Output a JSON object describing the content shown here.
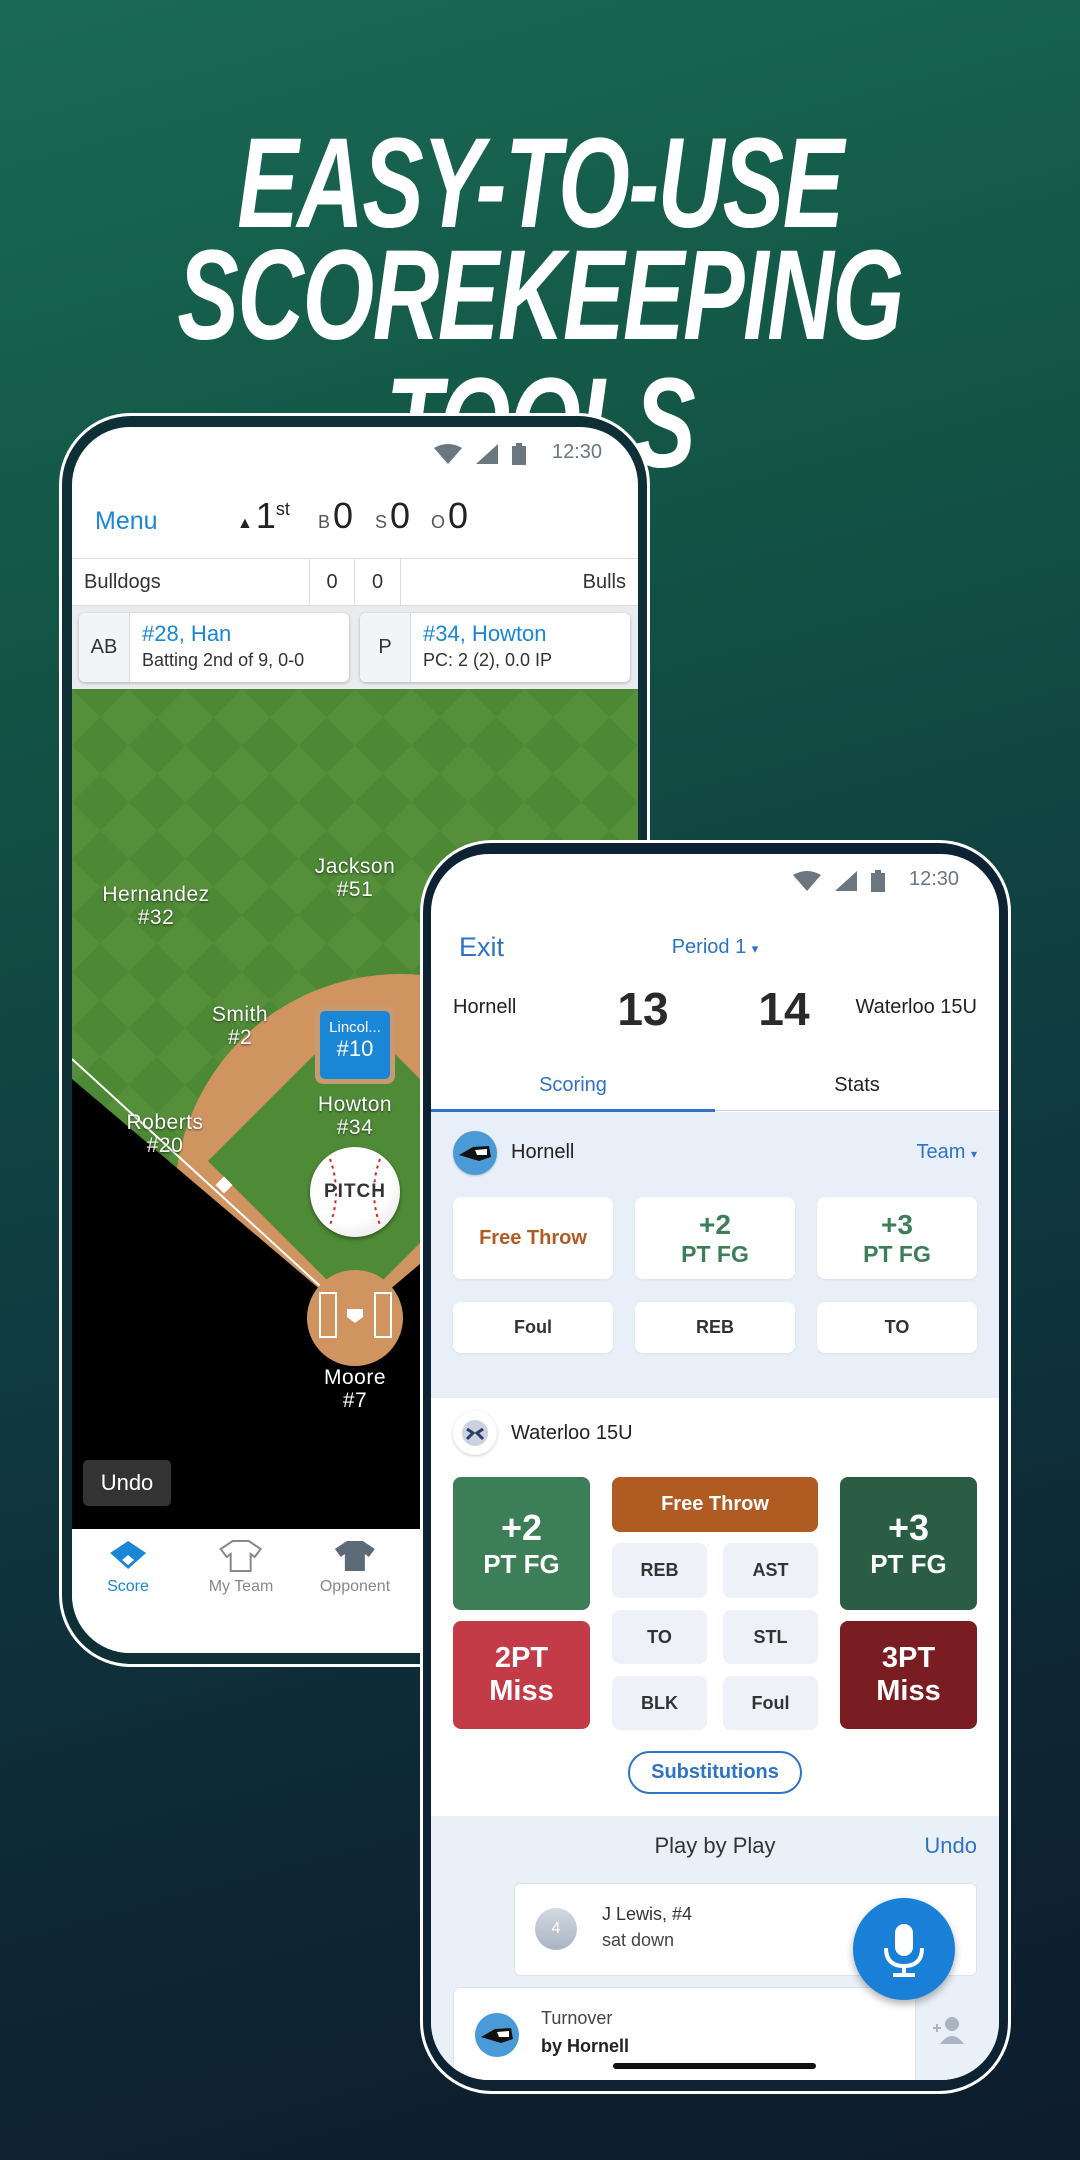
{
  "headline": {
    "line1": "EASY-TO-USE",
    "line2": "SCOREKEEPING TOOLS"
  },
  "colors": {
    "baseball_blue": "#1a86d6",
    "app_blue": "#2f73c5",
    "green_2pt": "#3b7e58",
    "green_3pt": "#2a5d43",
    "red_2pt_miss": "#c23b46",
    "red_3pt_miss": "#7a1d23",
    "orange_free_throw": "#b05b22",
    "field_green": "#4f8a36",
    "infield_dirt": "#d09461"
  },
  "baseball_app": {
    "status": {
      "time": "12:30",
      "icons": [
        "wifi-icon",
        "signal-icon",
        "battery-icon"
      ]
    },
    "header": {
      "menu": "Menu",
      "inning_arrow": "▲",
      "inning": "1",
      "inning_suffix": "st",
      "balls_label": "B",
      "balls": "0",
      "strikes_label": "S",
      "strikes": "0",
      "outs_label": "O",
      "outs": "0"
    },
    "scoreboard": {
      "away_team": "Bulldogs",
      "away_score": "0",
      "home_score": "0",
      "home_team": "Bulls"
    },
    "at_bat": {
      "label": "AB",
      "name": "#28, Han",
      "detail": "Batting 2nd of 9, 0-0"
    },
    "pitcher": {
      "label": "P",
      "name": "#34, Howton",
      "detail": "PC: 2 (2), 0.0 IP"
    },
    "field_players": [
      {
        "name": "Hernandez",
        "number": "#32"
      },
      {
        "name": "Jackson",
        "number": "#51"
      },
      {
        "name": "Smith",
        "number": "#2"
      },
      {
        "name": "Roberts",
        "number": "#20"
      },
      {
        "name": "Howton",
        "number": "#34"
      },
      {
        "name": "Moore",
        "number": "#7"
      }
    ],
    "runner": {
      "name": "Lincol...",
      "number": "#10"
    },
    "pitch_button": "PITCH",
    "undo": "Undo",
    "nav": [
      {
        "label": "Score",
        "icon": "diamond-icon",
        "active": true
      },
      {
        "label": "My Team",
        "icon": "jersey-outline-icon",
        "active": false
      },
      {
        "label": "Opponent",
        "icon": "jersey-filled-icon",
        "active": false
      }
    ]
  },
  "basketball_app": {
    "status": {
      "time": "12:30"
    },
    "header": {
      "exit": "Exit",
      "period": "Period 1",
      "period_caret": "▾"
    },
    "score": {
      "home_team": "Hornell",
      "home_score": "13",
      "away_score": "14",
      "away_team": "Waterloo 15U"
    },
    "tabs": [
      {
        "label": "Scoring",
        "active": true
      },
      {
        "label": "Stats",
        "active": false
      }
    ],
    "team1": {
      "name": "Hornell",
      "selector": "Team",
      "selector_caret": "▾",
      "buttons": {
        "free_throw": "Free Throw",
        "two_pt_top": "+2",
        "two_pt_bottom": "PT FG",
        "three_pt_top": "+3",
        "three_pt_bottom": "PT FG",
        "foul": "Foul",
        "reb": "REB",
        "to": "TO"
      }
    },
    "team2": {
      "name": "Waterloo 15U",
      "buttons": {
        "two_pt_top": "+2",
        "two_pt_bottom": "PT FG",
        "three_pt_top": "+3",
        "three_pt_bottom": "PT FG",
        "miss2_top": "2PT",
        "miss2_bottom": "Miss",
        "miss3_top": "3PT",
        "miss3_bottom": "Miss",
        "free_throw": "Free Throw",
        "reb": "REB",
        "ast": "AST",
        "to": "TO",
        "stl": "STL",
        "blk": "BLK",
        "foul": "Foul"
      },
      "substitutions": "Substitutions"
    },
    "play_by_play": {
      "title": "Play by Play",
      "undo": "Undo",
      "entries": [
        {
          "badge": "4",
          "title": "J Lewis, #4",
          "detail": "sat down"
        },
        {
          "title": "Turnover",
          "detail": "by Hornell"
        }
      ]
    }
  }
}
